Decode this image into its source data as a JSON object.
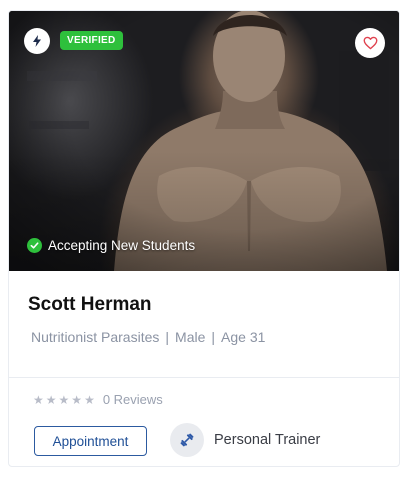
{
  "card": {
    "verified_label": "VERIFIED",
    "status_text": "Accepting New Students",
    "name": "Scott Herman",
    "meta": [
      "Nutritionist Parasites",
      "Male",
      "Age 31"
    ],
    "meta_separator": "|",
    "rating": {
      "stars_filled": 0,
      "stars_total": 5,
      "reviews_text": "0 Reviews"
    },
    "appointment_label": "Appointment",
    "specialty_label": "Personal Trainer"
  },
  "icons": {
    "bolt": "bolt-icon",
    "favorite": "heart-icon",
    "check": "check-circle-icon",
    "specialty": "dumbbell-icon",
    "star": "star-icon"
  },
  "colors": {
    "verified": "#2ec03c",
    "accent": "#1f4f96",
    "heart": "#e0424f",
    "muted_text": "#8b93a3"
  }
}
